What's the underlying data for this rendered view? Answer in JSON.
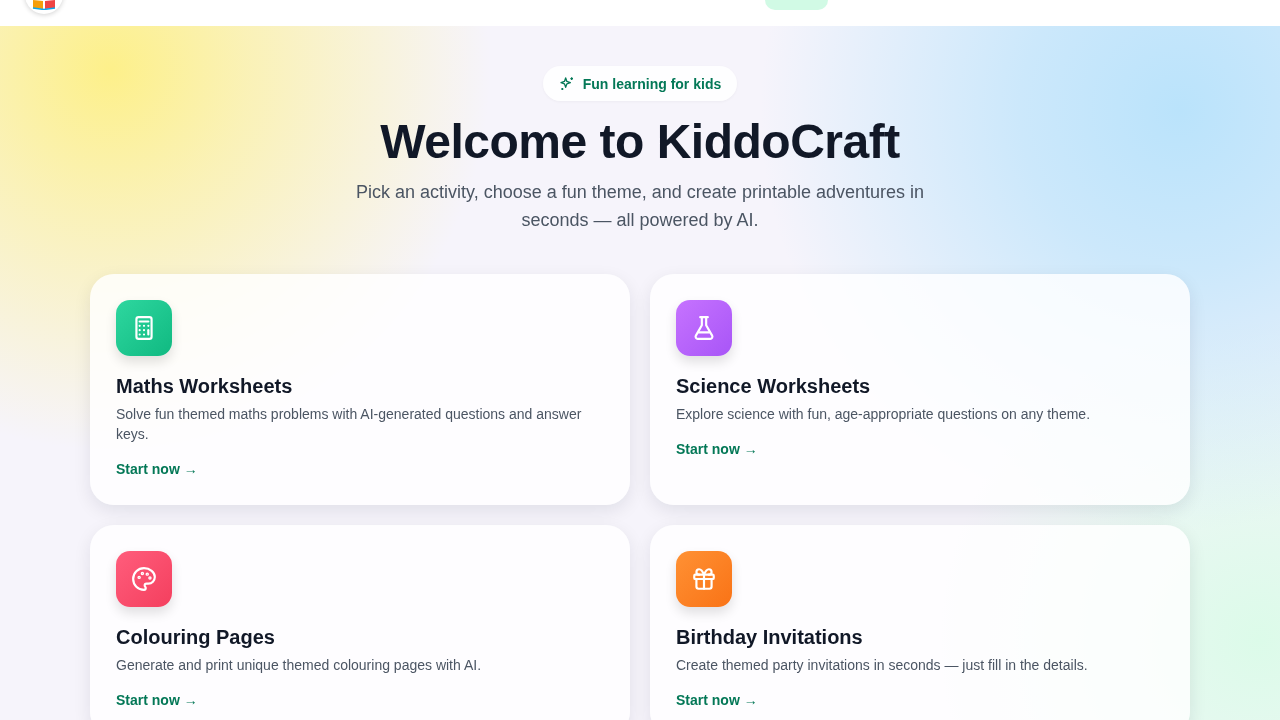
{
  "hero": {
    "badge": "Fun learning for kids",
    "title": "Welcome to KiddoCraft",
    "subtitle": "Pick an activity, choose a fun theme, and create printable adventures in seconds — all powered by AI."
  },
  "activities": [
    {
      "kind": "calculator",
      "color": "#10b981",
      "title": "Maths Worksheets",
      "description": "Solve fun themed maths problems with AI-generated questions and answer keys.",
      "link": "Start now →"
    },
    {
      "kind": "flask",
      "color": "#a855f7",
      "title": "Science Worksheets",
      "description": "Explore science with fun, age-appropriate questions on any theme.",
      "link": "Start now →"
    },
    {
      "kind": "palette",
      "color": "#f43f5e",
      "title": "Colouring Pages",
      "description": "Generate and print unique themed colouring pages with AI.",
      "link": "Start now →"
    },
    {
      "kind": "gift",
      "color": "#f97316",
      "title": "Birthday Invitations",
      "description": "Create themed party invitations in seconds — just fill in the details.",
      "link": "Start now →"
    }
  ]
}
